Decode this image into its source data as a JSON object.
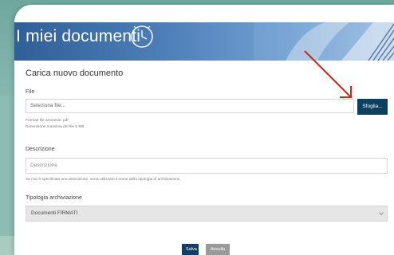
{
  "banner": {
    "title": "I miei documenti"
  },
  "section": {
    "title": "Carica nuovo documento"
  },
  "file": {
    "label": "File",
    "placeholder": "Seleziona file...",
    "browse_label": "Sfoglia...",
    "hint_formats": "Formati file ammessi: pdf",
    "hint_size": "Dimensione massima del file 5 MB."
  },
  "description": {
    "label": "Descrizione",
    "placeholder": "Descrizione",
    "hint": "Se non è specificata una descrizione, verrà utilizzato il nome della tipologia di archiviazione."
  },
  "archive_type": {
    "label": "Tipologia archiviazione",
    "selected": "Documenti FIRMATI"
  },
  "actions": {
    "save_label": "Salva",
    "cancel_label": "Annulla"
  },
  "colors": {
    "primary": "#0d3f5e",
    "cancel": "#9a9a9a",
    "annotation_arrow": "#e02020"
  },
  "icons": [
    "clock-icon",
    "chevron-down-icon",
    "red-arrow-annotation"
  ]
}
